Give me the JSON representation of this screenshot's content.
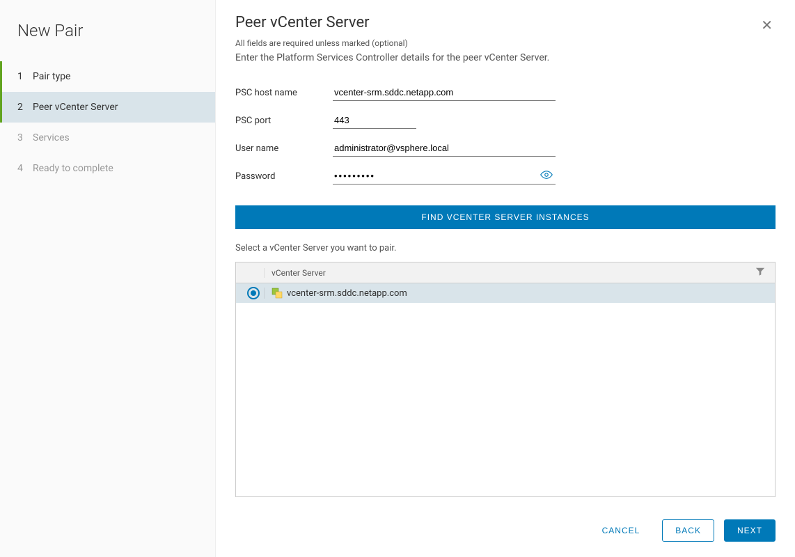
{
  "sidebar": {
    "title": "New Pair",
    "steps": [
      {
        "num": "1",
        "label": "Pair type"
      },
      {
        "num": "2",
        "label": "Peer vCenter Server"
      },
      {
        "num": "3",
        "label": "Services"
      },
      {
        "num": "4",
        "label": "Ready to complete"
      }
    ]
  },
  "main": {
    "title": "Peer vCenter Server",
    "subtitle": "All fields are required unless marked (optional)",
    "description": "Enter the Platform Services Controller details for the peer vCenter Server."
  },
  "form": {
    "host_label": "PSC host name",
    "host_value": "vcenter-srm.sddc.netapp.com",
    "port_label": "PSC port",
    "port_value": "443",
    "user_label": "User name",
    "user_value": "administrator@vsphere.local",
    "pass_label": "Password",
    "pass_value": "•••••••••",
    "find_button": "FIND VCENTER SERVER INSTANCES"
  },
  "table": {
    "select_label": "Select a vCenter Server you want to pair.",
    "header": "vCenter Server",
    "rows": [
      {
        "name": "vcenter-srm.sddc.netapp.com"
      }
    ]
  },
  "footer": {
    "cancel": "CANCEL",
    "back": "BACK",
    "next": "NEXT"
  }
}
